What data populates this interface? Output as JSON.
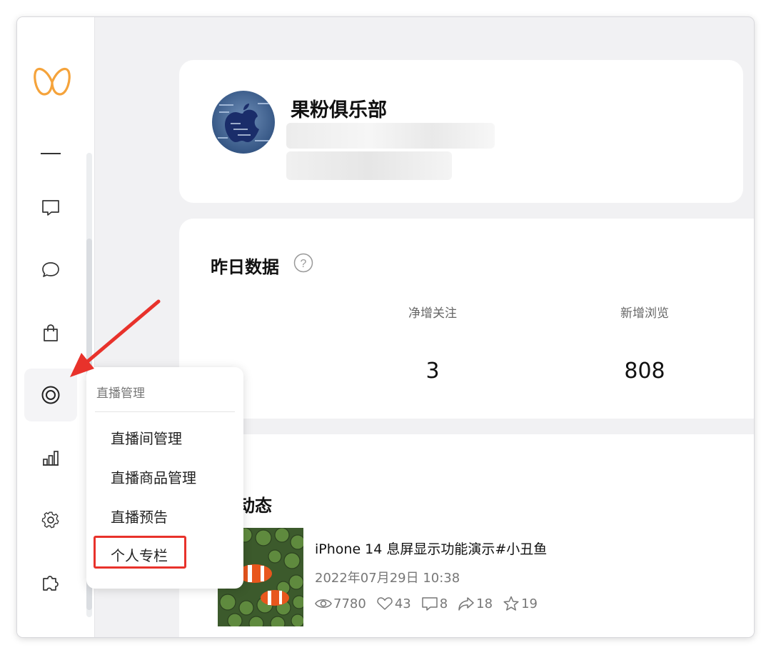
{
  "profile": {
    "name": "果粉俱乐部"
  },
  "stats": {
    "title": "昨日数据",
    "help_icon": "?",
    "items": [
      {
        "label": "净增关注",
        "value": "3"
      },
      {
        "label": "新增浏览",
        "value": "808"
      }
    ]
  },
  "activity": {
    "title_visible": "近动态",
    "post": {
      "title": "iPhone 14 息屏显示功能演示#小丑鱼",
      "date": "2022年07月29日 10:38",
      "views": "7780",
      "likes": "43",
      "comments": "8",
      "shares": "18",
      "favorites": "19"
    }
  },
  "menu": {
    "header": "直播管理",
    "items": [
      "直播间管理",
      "直播商品管理",
      "直播预告",
      "个人专栏"
    ]
  },
  "colors": {
    "logo": "#f5a33b",
    "highlight": "#e8322b",
    "arrow": "#e8322b"
  },
  "icons": {
    "sidebar": [
      "minus-icon",
      "message-square-icon",
      "chat-bubble-icon",
      "shopping-bag-icon",
      "live-circle-icon",
      "bar-chart-icon",
      "gear-icon",
      "puzzle-icon"
    ]
  }
}
